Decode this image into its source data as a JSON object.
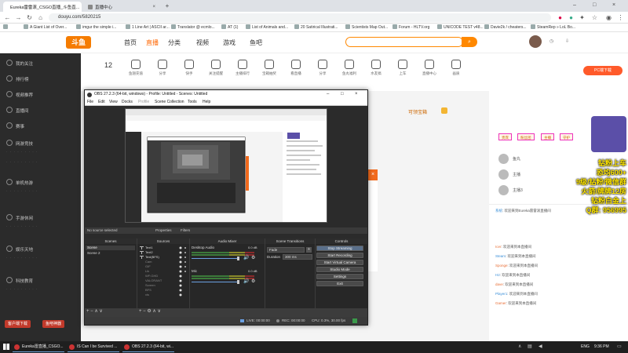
{
  "browser": {
    "tabs": [
      {
        "label": "Eureka雷雷滚_CSGO直播_斗鱼直..."
      },
      {
        "label": "直播中心"
      }
    ],
    "url": "douyu.com/5820215",
    "bookmarks": [
      "A Giant List of Over...",
      "imgur the simple i...",
      "1 Line Art | ASCII ar...",
      "Translator @ ecmlo...",
      "AT (1)",
      "List of Animals and...",
      "20 Satirical Illustrati...",
      "Scientists Map Out...",
      "Forum - HLTV.org",
      "UNICODE TEST v48...",
      "Davie2k / cheaters...",
      "SteamRep » LoL Bo..."
    ]
  },
  "site": {
    "logo": "斗鱼",
    "nav": [
      "首页",
      "直播",
      "分类",
      "视频",
      "游戏",
      "鱼吧"
    ],
    "room_icons": [
      {
        "label": "12"
      },
      {
        "label": "鱼翅充值"
      },
      {
        "label": "分享"
      },
      {
        "label": "快手"
      },
      {
        "label": "关注提醒"
      },
      {
        "label": "主播排行"
      },
      {
        "label": "宝箱抽奖"
      },
      {
        "label": "看直播"
      },
      {
        "label": "分享"
      },
      {
        "label": "鱼丸福利"
      },
      {
        "label": "水友搞"
      },
      {
        "label": "上车"
      },
      {
        "label": "直播中心"
      },
      {
        "label": "画质"
      }
    ],
    "sidebar": {
      "sections": [
        "我的关注",
        "排行榜",
        "视频推荐",
        "直播间",
        "赛事"
      ],
      "sub_sections": [
        "网游竞技",
        "单机热游",
        "手游休闲",
        "娱乐天地",
        "科技教育"
      ],
      "btn_left": "客户端下载",
      "btn_right": "鱼吧神器"
    },
    "right_panel": {
      "tab_labels": [
        "贵宾",
        "粉丝团",
        "主播",
        "守护"
      ],
      "users": [
        "鱼丸",
        "主播",
        "主播3"
      ],
      "follow_label": "可领宝箱",
      "chat": [
        {
          "user": "系统",
          "text": "欢迎来到Eureka雷雷滚直播间"
        },
        {
          "user": "Icer",
          "text": "欢迎来到本直播间"
        },
        {
          "user": "Steam",
          "text": "欢迎来到本直播间"
        },
        {
          "user": "Sponge",
          "text": "欢迎来到本直播间"
        },
        {
          "user": "H2",
          "text": "欢迎来到本直播间"
        },
        {
          "user": "dave",
          "text": "欢迎来到本直播间"
        },
        {
          "user": "Player1",
          "text": "欢迎来到本直播间"
        },
        {
          "user": "Gamer",
          "text": "欢迎来到本直播间"
        }
      ],
      "promo_lines": [
        "钻粉上车",
        "恐均600+",
        "9级/钻粉/微信群",
        "火箭/牌牌12房",
        "钻粉白金上",
        "Q群: 956995"
      ]
    }
  },
  "obs": {
    "title": "OBS 27.2.3 (64-bit, windows) - Profile: Untitled - Scenes: Untitled",
    "menu": [
      "File",
      "Edit",
      "View",
      "Docks",
      "Profile",
      "Scene Collection",
      "Tools",
      "Help"
    ],
    "status_left": "No source selected",
    "status_props": "Properties",
    "status_filters": "Filters",
    "docks": {
      "scenes": "Scenes",
      "sources": "Sources",
      "mixer": "Audio Mixer",
      "transitions": "Scene Transitions",
      "controls": "Controls"
    },
    "scenes": [
      "Scene",
      "Scene 2"
    ],
    "sources": [
      "Text1",
      "Text2",
      "Text(BFS)",
      "Cam",
      "GIF",
      "Lik",
      "WF:GHD",
      "VALORANT",
      "Screen",
      "BFS",
      "vis"
    ],
    "mixer": [
      {
        "name": "Desktop Audio",
        "db": "0.0 dB"
      },
      {
        "name": "Mic",
        "db": "0.0 dB"
      }
    ],
    "transition": "Fade",
    "duration_label": "Duration",
    "duration": "300 ms",
    "controls": [
      "Stop Streaming",
      "Start Recording",
      "Start Virtual Camera",
      "Studio Mode",
      "Settings",
      "Exit"
    ],
    "status": {
      "live": "LIVE: 00:00:00",
      "rec": "REC: 00:00:00",
      "cpu": "CPU: 0.3%, 30.00 fps"
    }
  },
  "taskbar": {
    "apps": [
      {
        "label": "Eureka雷直播_CSGO..."
      },
      {
        "label": "IS Can I be Survived ..."
      },
      {
        "label": "OBS 27.2.3 (64-bit, wi..."
      }
    ],
    "lang": "ENG",
    "time": "9:36 PM"
  },
  "colors": {
    "douyu_orange": "#f57c00",
    "obs_bg": "#3c3c3c",
    "sidebar_bg": "#2b2b2b",
    "live_red": "#c23a2b"
  }
}
